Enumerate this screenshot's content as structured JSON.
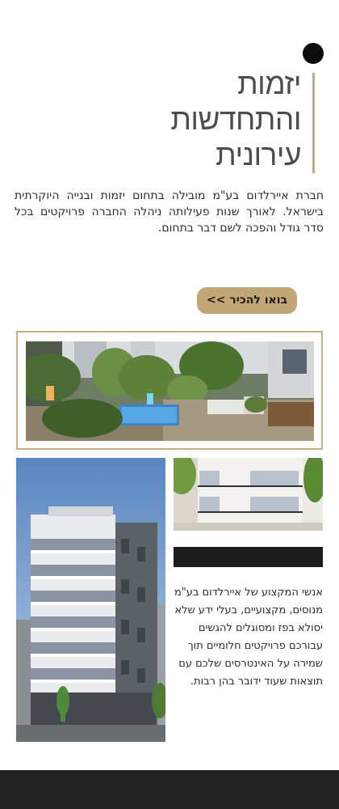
{
  "hero": {
    "headline_line1": "יזמות",
    "headline_line2": "והתחדשות",
    "headline_line3": "עירונית"
  },
  "intro": {
    "text": "חברת איירלדום בע\"מ מובילה בתחום יזמות ובנייה היוקרתית בישראל. לאורך שנות פעילותה ניהלה החברה פרויקטים בכל סדר גודל והפכה לשם דבר בתחום."
  },
  "cta": {
    "label": "בואו להכיר >>"
  },
  "team": {
    "text": "אנשי המקצוע של איירלדום בע\"מ מנוסים, מקצועיים, בעלי ידע שלא יסולא בפז ומסוגלים להגשים עבורכם פרויקטים חלומיים תוך שמירה על האינטרסים שלכם עם תוצאות שעוד ידובר בהן רבות."
  },
  "images": {
    "garden": "garden-pool-image",
    "building": "building-render-image",
    "balcony": "balcony-facade-image"
  },
  "colors": {
    "accent": "#c2a677",
    "dark": "#1c1c1c",
    "headline": "#4d4d4d",
    "footer": "#232323"
  }
}
